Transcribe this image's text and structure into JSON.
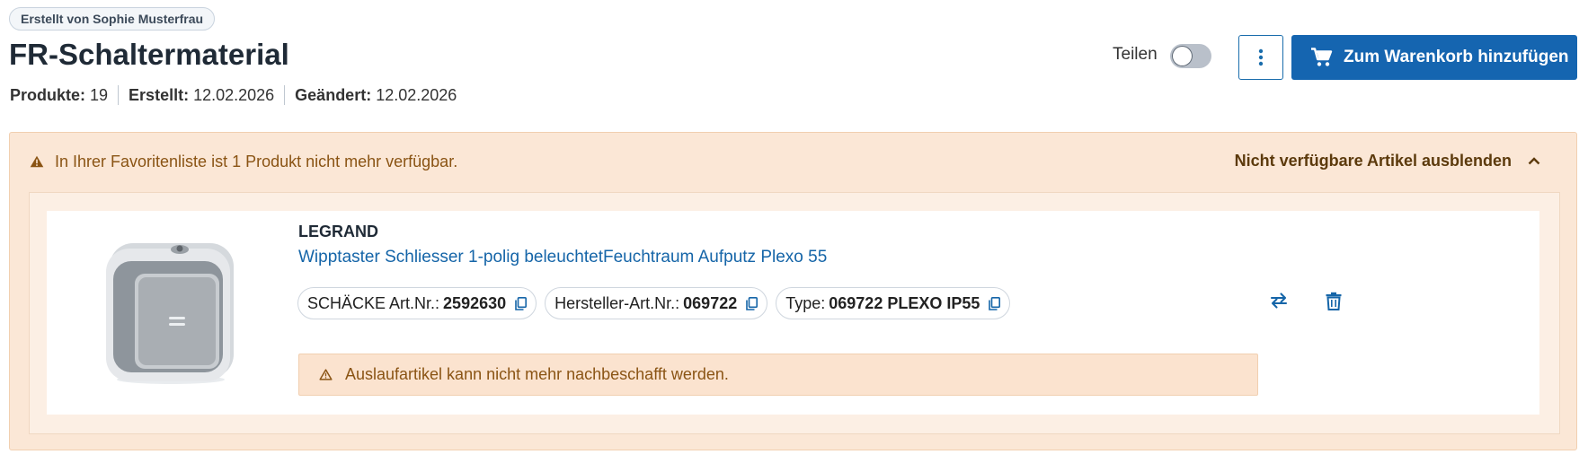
{
  "header": {
    "creator_badge": "Erstellt von Sophie Musterfrau",
    "title": "FR-Schaltermaterial",
    "meta": {
      "products_label": "Produkte:",
      "products_value": "19",
      "created_label": "Erstellt:",
      "created_value": "12.02.2026",
      "changed_label": "Geändert:",
      "changed_value": "12.02.2026"
    }
  },
  "actions": {
    "share_label": "Teilen",
    "share_enabled": false,
    "more_icon": "vertical-dots-icon",
    "cart_icon": "cart-icon",
    "cart_label": "Zum Warenkorb hinzufügen"
  },
  "alert": {
    "icon": "warning-icon",
    "text": "In Ihrer Favoritenliste ist 1 Produkt nicht mehr verfügbar.",
    "toggle_label": "Nicht verfügbare Artikel ausblenden",
    "toggle_icon": "chevron-up-icon"
  },
  "product": {
    "brand": "LEGRAND",
    "name": "Wipptaster Schliesser 1-polig beleuchtetFeuchtraum Aufputz Plexo 55",
    "chips": [
      {
        "label": "SCHÄCKE Art.Nr.:",
        "value": "2592630"
      },
      {
        "label": "Hersteller-Art.Nr.:",
        "value": "069722"
      },
      {
        "label": "Type:",
        "value": "069722 PLEXO IP55"
      }
    ],
    "notice": "Auslaufartikel kann nicht mehr nachbeschafft werden.",
    "swap_icon": "swap-icon",
    "delete_icon": "trash-icon"
  },
  "colors": {
    "primary": "#1565b0",
    "alert_bg": "#fbe7d6",
    "alert_text": "#8a5414",
    "link": "#1565a8"
  }
}
